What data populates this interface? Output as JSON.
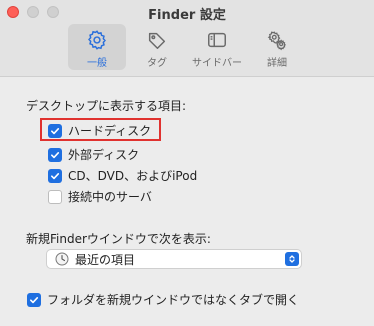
{
  "window": {
    "title": "Finder 設定"
  },
  "tabs": [
    {
      "label": "一般",
      "icon": "gear-icon",
      "active": true
    },
    {
      "label": "タグ",
      "icon": "tag-icon",
      "active": false
    },
    {
      "label": "サイドバー",
      "icon": "sidebar-icon",
      "active": false
    },
    {
      "label": "詳細",
      "icon": "gears-icon",
      "active": false
    }
  ],
  "desktop_section": {
    "label": "デスクトップに表示する項目:",
    "items": [
      {
        "label": "ハードディスク",
        "checked": true
      },
      {
        "label": "外部ディスク",
        "checked": true
      },
      {
        "label": "CD、DVD、およびiPod",
        "checked": true
      },
      {
        "label": "接続中のサーバ",
        "checked": false
      }
    ]
  },
  "new_window": {
    "label": "新規Finderウインドウで次を表示:",
    "selected": "最近の項目",
    "icon": "clock-icon"
  },
  "tabs_option": {
    "label": "フォルダを新規ウインドウではなくタブで開く",
    "checked": true
  },
  "colors": {
    "accent": "#1f6fe0",
    "highlight": "#e0322f"
  }
}
